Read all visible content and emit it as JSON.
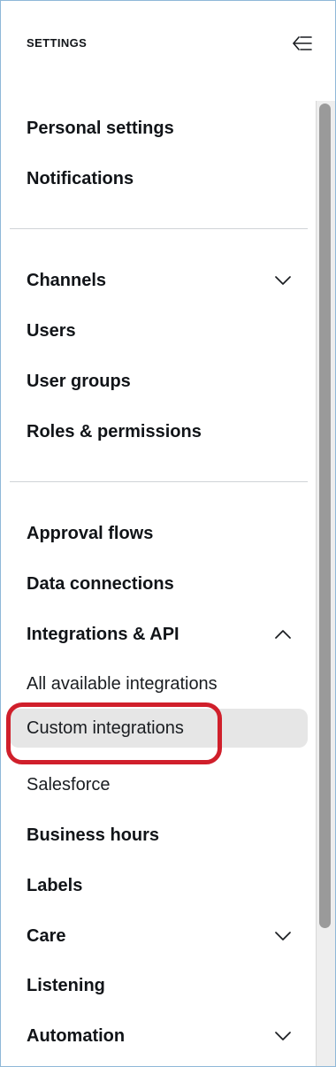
{
  "header": {
    "title": "SETTINGS",
    "collapse_icon": "collapse-left-icon"
  },
  "nav": {
    "items": [
      {
        "label": "Personal settings",
        "style": "bold"
      },
      {
        "label": "Notifications",
        "style": "bold"
      },
      {
        "label": "Channels",
        "style": "bold",
        "chevron": "down"
      },
      {
        "label": "Users",
        "style": "bold"
      },
      {
        "label": "User groups",
        "style": "bold"
      },
      {
        "label": "Roles & permissions",
        "style": "bold"
      },
      {
        "label": "Approval flows",
        "style": "bold"
      },
      {
        "label": "Data connections",
        "style": "bold"
      },
      {
        "label": "Integrations & API",
        "style": "bold",
        "chevron": "up",
        "expanded": true
      },
      {
        "label": "All available integrations",
        "style": "sub"
      },
      {
        "label": "Custom integrations",
        "style": "sub",
        "selected": true
      },
      {
        "label": "Salesforce",
        "style": "sub"
      },
      {
        "label": "Business hours",
        "style": "bold"
      },
      {
        "label": "Labels",
        "style": "bold"
      },
      {
        "label": "Care",
        "style": "bold",
        "chevron": "down"
      },
      {
        "label": "Listening",
        "style": "bold"
      },
      {
        "label": "Automation",
        "style": "bold",
        "chevron": "down"
      }
    ]
  },
  "colors": {
    "highlight": "#d01f2b",
    "selected_bg": "#e6e6e6",
    "border": "#8fb8d8"
  }
}
